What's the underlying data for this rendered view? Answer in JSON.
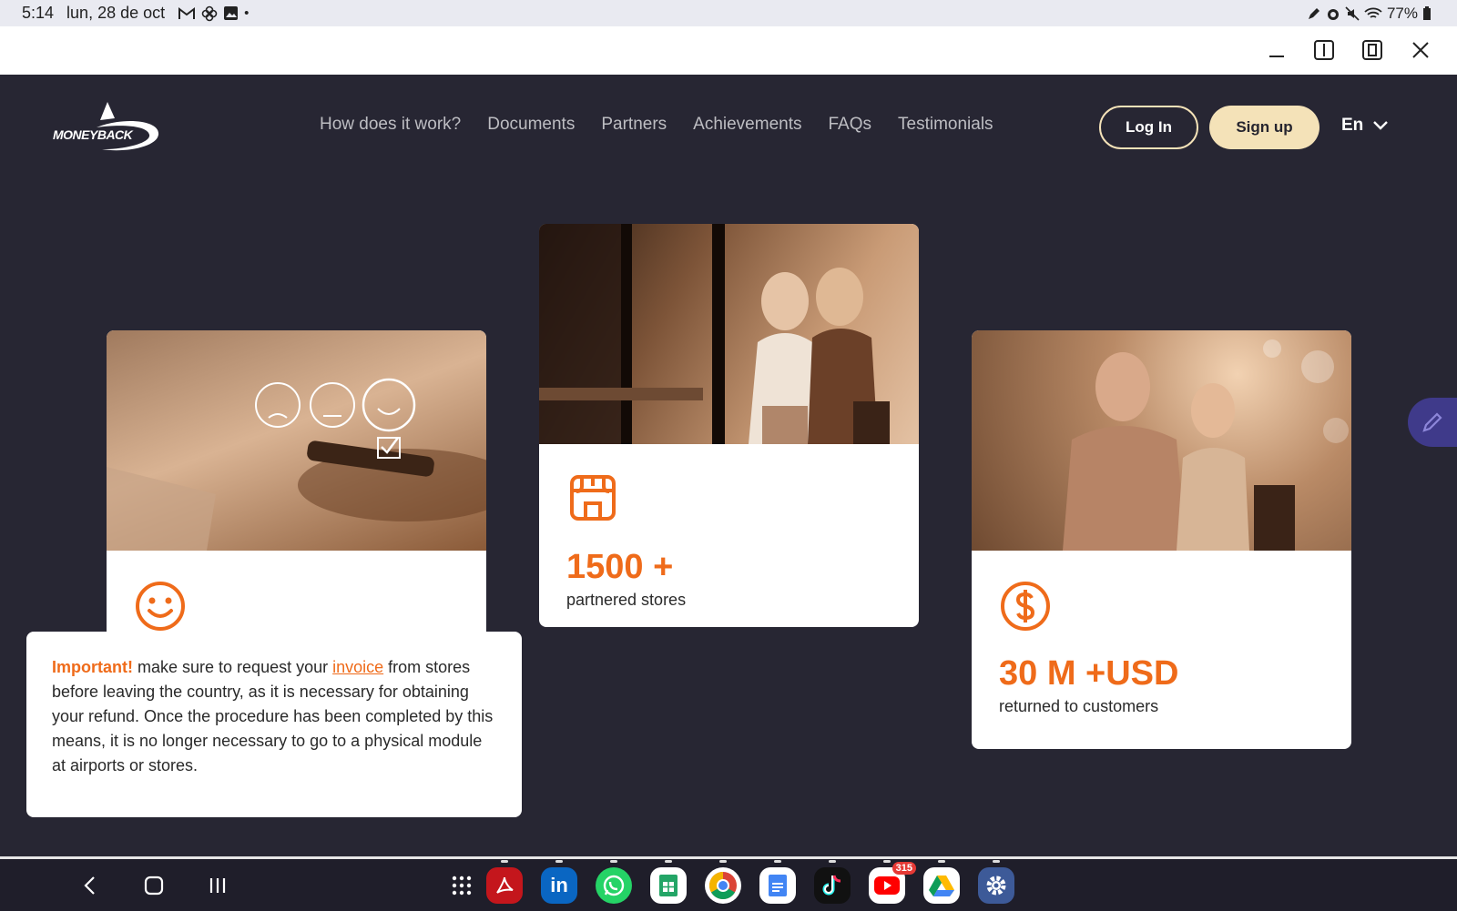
{
  "status_bar": {
    "time": "5:14",
    "date": "lun, 28 de oct",
    "battery": "77%",
    "left_icons": [
      "gmail-icon",
      "pinwheel-icon",
      "gallery-icon"
    ],
    "right_icons": [
      "pen-icon",
      "alarm-icon",
      "mute-icon",
      "wifi-icon",
      "battery-icon"
    ]
  },
  "site": {
    "logo_text": "MONEYBACK",
    "nav": [
      "How does it work?",
      "Documents",
      "Partners",
      "Achievements",
      "FAQs",
      "Testimonials"
    ],
    "login_label": "Log In",
    "signup_label": "Sign up",
    "language": "En"
  },
  "cards": [
    {
      "icon": "smiley-icon",
      "number": "",
      "caption": ""
    },
    {
      "icon": "store-icon",
      "number": "1500 +",
      "caption": "partnered stores"
    },
    {
      "icon": "dollar-icon",
      "number": "30 M +USD",
      "caption": "returned to customers"
    }
  ],
  "notice": {
    "important": "Important!",
    "text_before": " make sure to request your ",
    "link": "invoice",
    "text_after": " from stores before leaving the country, as it is necessary for obtaining your refund. Once the procedure has been completed by this means, it is no longer necessary to go to a physical module at airports or stores."
  },
  "dock": {
    "apps": [
      "apps-grid",
      "adobe-acrobat",
      "linkedin",
      "whatsapp",
      "google-sheets",
      "chrome",
      "google-docs",
      "tiktok",
      "youtube",
      "google-drive",
      "settings"
    ],
    "youtube_badge": "315"
  },
  "colors": {
    "accent": "#ef6b1a",
    "background": "#272633",
    "signup": "#f4e2b8"
  }
}
